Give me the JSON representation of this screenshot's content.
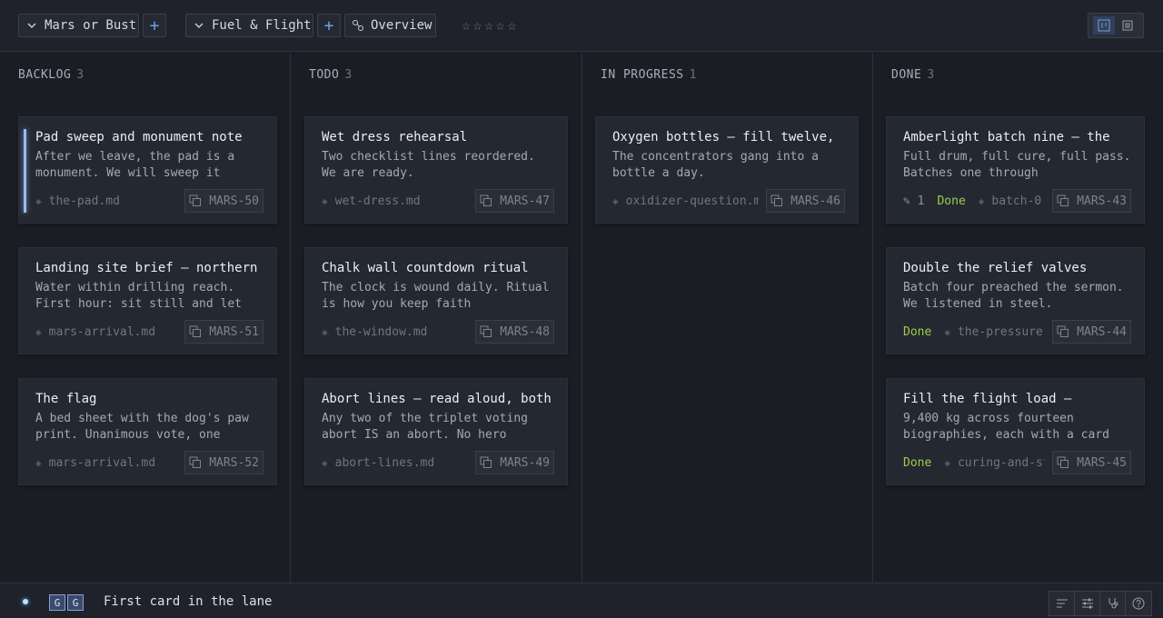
{
  "header": {
    "project_label": "Mars or Bust",
    "board_label": "Fuel & Flight",
    "overview_label": "Overview",
    "rating": 0,
    "rating_max": 5
  },
  "columns": [
    {
      "name": "BACKLOG",
      "count": "3",
      "cards": [
        {
          "title": "Pad sweep and monument note",
          "body": "After we leave, the pad is a monument. We will sweep it",
          "file": "the-pad.md",
          "key": "MARS-50",
          "selected": true
        },
        {
          "title": "Landing site brief — northern",
          "body": "Water within drilling reach. First hour: sit still and let",
          "file": "mars-arrival.md",
          "key": "MARS-51"
        },
        {
          "title": "The flag",
          "body": "A bed sheet with the dog's paw print. Unanimous vote, one",
          "file": "mars-arrival.md",
          "key": "MARS-52"
        }
      ]
    },
    {
      "name": "TODO",
      "count": "3",
      "cards": [
        {
          "title": "Wet dress rehearsal",
          "body": "Two checklist lines reordered. We are ready.",
          "file": "wet-dress.md",
          "key": "MARS-47"
        },
        {
          "title": "Chalk wall countdown ritual",
          "body": "The clock is wound daily. Ritual is how you keep faith",
          "file": "the-window.md",
          "key": "MARS-48"
        },
        {
          "title": "Abort lines — read aloud, both",
          "body": "Any two of the triplet voting abort IS an abort. No hero",
          "file": "abort-lines.md",
          "key": "MARS-49"
        }
      ]
    },
    {
      "name": "IN PROGRESS",
      "count": "1",
      "cards": [
        {
          "title": "Oxygen bottles — fill twelve,",
          "body": "The concentrators gang into a bottle a day.",
          "file": "oxidizer-question.md",
          "key": "MARS-46"
        }
      ]
    },
    {
      "name": "DONE",
      "count": "3",
      "cards": [
        {
          "title": "Amberlight batch nine — the",
          "body": "Full drum, full cure, full pass. Batches one through",
          "file": "batch-0",
          "key": "MARS-43",
          "edits": "1",
          "status": "Done"
        },
        {
          "title": "Double the relief valves",
          "body": "Batch four preached the sermon. We listened in steel.",
          "file": "the-pressure",
          "key": "MARS-44",
          "status": "Done"
        },
        {
          "title": "Fill the flight load —",
          "body": "9,400 kg across fourteen biographies, each with a card",
          "file": "curing-and-st",
          "key": "MARS-45",
          "status": "Done"
        }
      ]
    }
  ],
  "footer": {
    "badge_left": "G",
    "badge_right": "G",
    "status_text": "First card in the lane"
  },
  "colors": {
    "accent": "#6ea0e6",
    "done": "#9ccc4a",
    "background": "#1a1d24",
    "card": "#242831"
  }
}
